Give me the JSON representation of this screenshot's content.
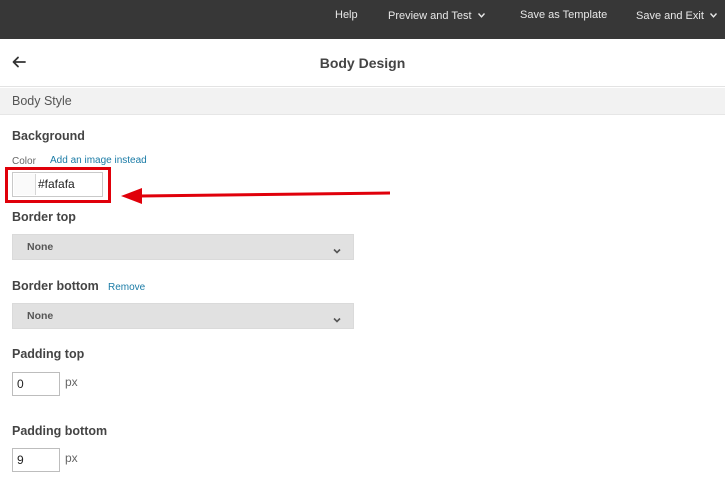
{
  "topbar": {
    "help": "Help",
    "preview": "Preview and Test",
    "save_template": "Save as Template",
    "save_exit": "Save and Exit"
  },
  "header": {
    "title": "Body Design"
  },
  "section": {
    "title": "Body Style"
  },
  "background": {
    "label": "Background",
    "color_label": "Color",
    "image_link": "Add an image instead",
    "color_value": "#fafafa"
  },
  "border_top": {
    "label": "Border top",
    "value": "None"
  },
  "border_bottom": {
    "label": "Border bottom",
    "remove_link": "Remove",
    "value": "None"
  },
  "padding_top": {
    "label": "Padding top",
    "value": "0",
    "unit": "px"
  },
  "padding_bottom": {
    "label": "Padding bottom",
    "value": "9",
    "unit": "px"
  },
  "colors": {
    "topbar": "#373737",
    "accent_link": "#1a7ba6",
    "annotation": "#e0000a"
  },
  "icons": {
    "back": "back-arrow-icon",
    "chevron": "chevron-down-icon"
  }
}
